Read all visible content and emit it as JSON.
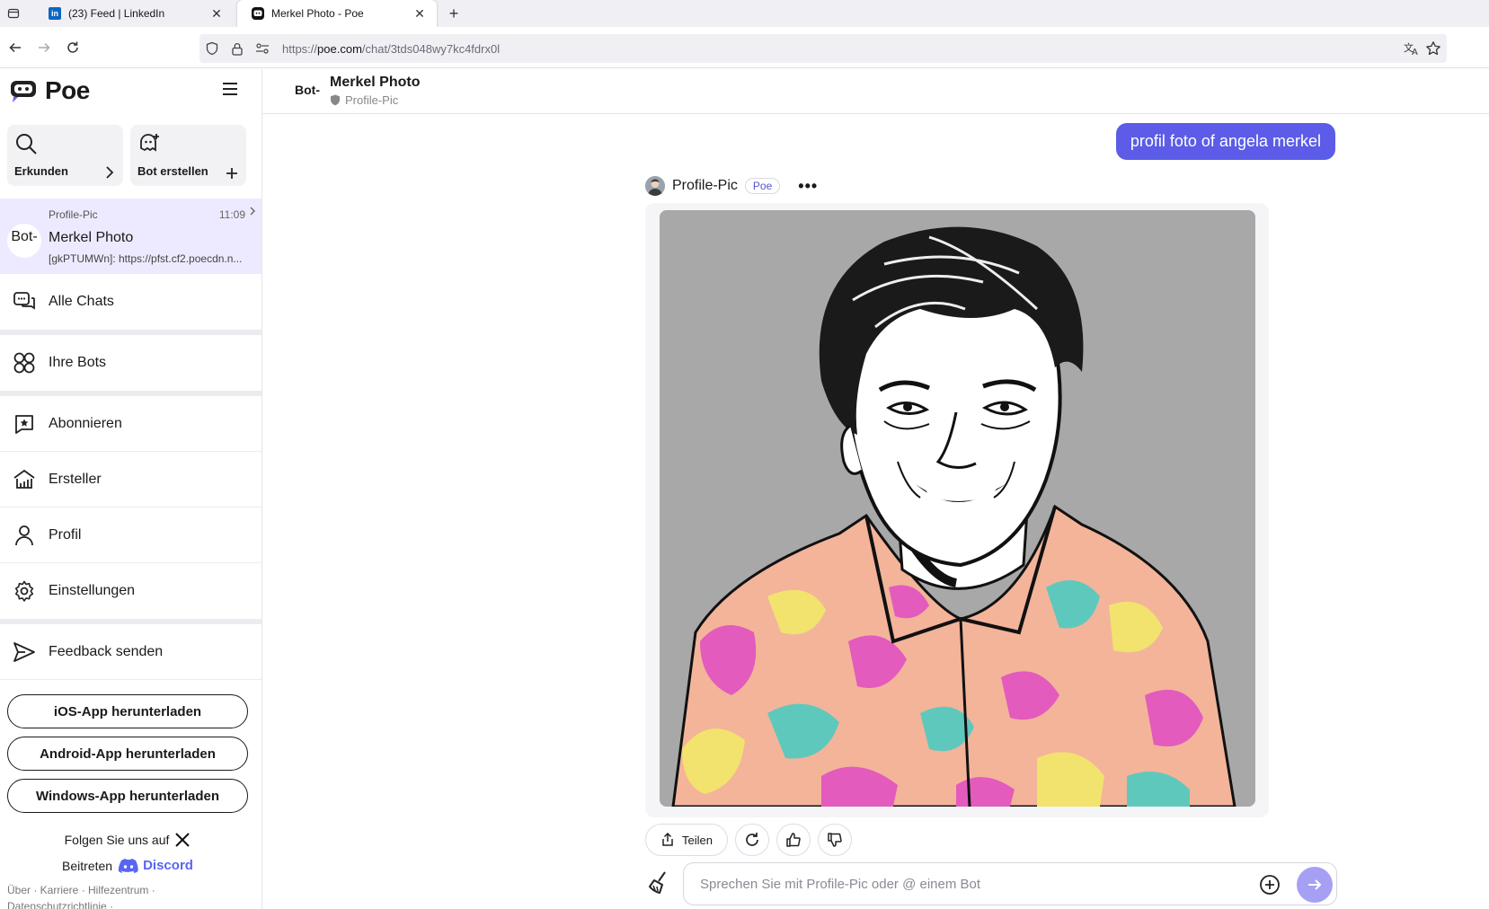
{
  "browser": {
    "tabs": [
      {
        "title": "(23) Feed | LinkedIn",
        "favicon": "linkedin-icon",
        "active": false
      },
      {
        "title": "Merkel Photo - Poe",
        "favicon": "poe-icon",
        "active": true
      }
    ],
    "url_prefix": "https://",
    "url_host": "poe.com",
    "url_path": "/chat/3tds048wy7kc4fdrx0l"
  },
  "sidebar": {
    "logo": "Poe",
    "explore": "Erkunden",
    "create_bot": "Bot erstellen",
    "active_chat": {
      "bot_name": "Profile-Pic",
      "time": "11:09",
      "title": "Merkel Photo",
      "preview": "[gkPTUMWn]: https://pfst.cf2.poecdn.n...",
      "avatar_text": "Bot-"
    },
    "menu": [
      {
        "label": "Alle Chats",
        "icon": "chats-icon"
      },
      {
        "label": "Ihre Bots",
        "icon": "bots-icon"
      },
      {
        "label": "Abonnieren",
        "icon": "subscribe-icon"
      },
      {
        "label": "Ersteller",
        "icon": "creators-icon"
      },
      {
        "label": "Profil",
        "icon": "profile-icon"
      },
      {
        "label": "Einstellungen",
        "icon": "settings-icon"
      },
      {
        "label": "Feedback senden",
        "icon": "send-feedback-icon"
      }
    ],
    "app_buttons": [
      "iOS-App herunterladen",
      "Android-App herunterladen",
      "Windows-App herunterladen"
    ],
    "follow_text": "Folgen Sie uns auf",
    "join_text": "Beitreten",
    "discord": "Discord",
    "footer_line1": "Über · Karriere · Hilfezentrum ·",
    "footer_line2": "Datenschutzrichtlinie ·"
  },
  "chat": {
    "title": "Merkel Photo",
    "bot": "Profile-Pic",
    "header_avatar_text": "Bot-",
    "user_message": "profil foto of angela merkel",
    "bot_badge": "Poe",
    "share": "Teilen",
    "input_placeholder": "Sprechen Sie mit Profile-Pic oder @ einem Bot"
  },
  "colors": {
    "accent": "#5c5ce8",
    "active_chat_bg": "#edeaff",
    "send_button": "#a6a0f5",
    "discord": "#5865f2"
  }
}
